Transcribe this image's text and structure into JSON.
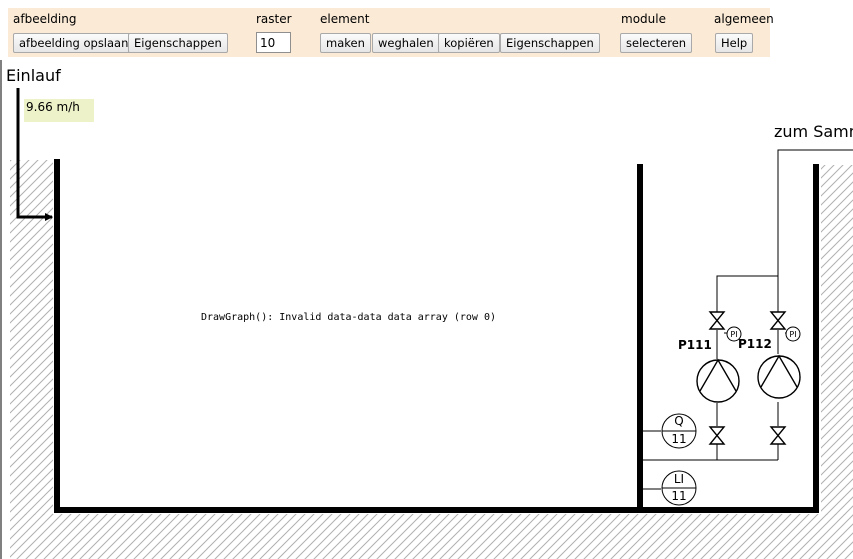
{
  "toolbar": {
    "groups": {
      "afbeelding": "afbeelding",
      "raster": "raster",
      "element": "element",
      "module": "module",
      "algemeen": "algemeen"
    },
    "buttons": {
      "save_image": "afbeelding opslaan",
      "image_properties": "Eigenschappen",
      "make": "maken",
      "remove": "weghalen",
      "copy": "kopiëren",
      "element_properties": "Eigenschappen",
      "select": "selecteren",
      "help": "Help"
    },
    "raster_value": "10"
  },
  "diagram": {
    "inlet_label": "Einlauf",
    "flow_value": "9.66 m/h",
    "outlet_label": "zum Samm",
    "error_message": "DrawGraph(): Invalid data-data data array (row 0)",
    "pump1_tag": "P111",
    "pump2_tag": "P112",
    "pressure_indicator": "PI",
    "flow_instrument_letter": "Q",
    "flow_instrument_number": "11",
    "level_instrument_letter": "LI",
    "level_instrument_number": "11"
  },
  "colors": {
    "toolbar_bg": "#fbead6",
    "flow_box_bg": "#eef2c8",
    "line": "#000000",
    "hatch": "#b0b0b0"
  }
}
